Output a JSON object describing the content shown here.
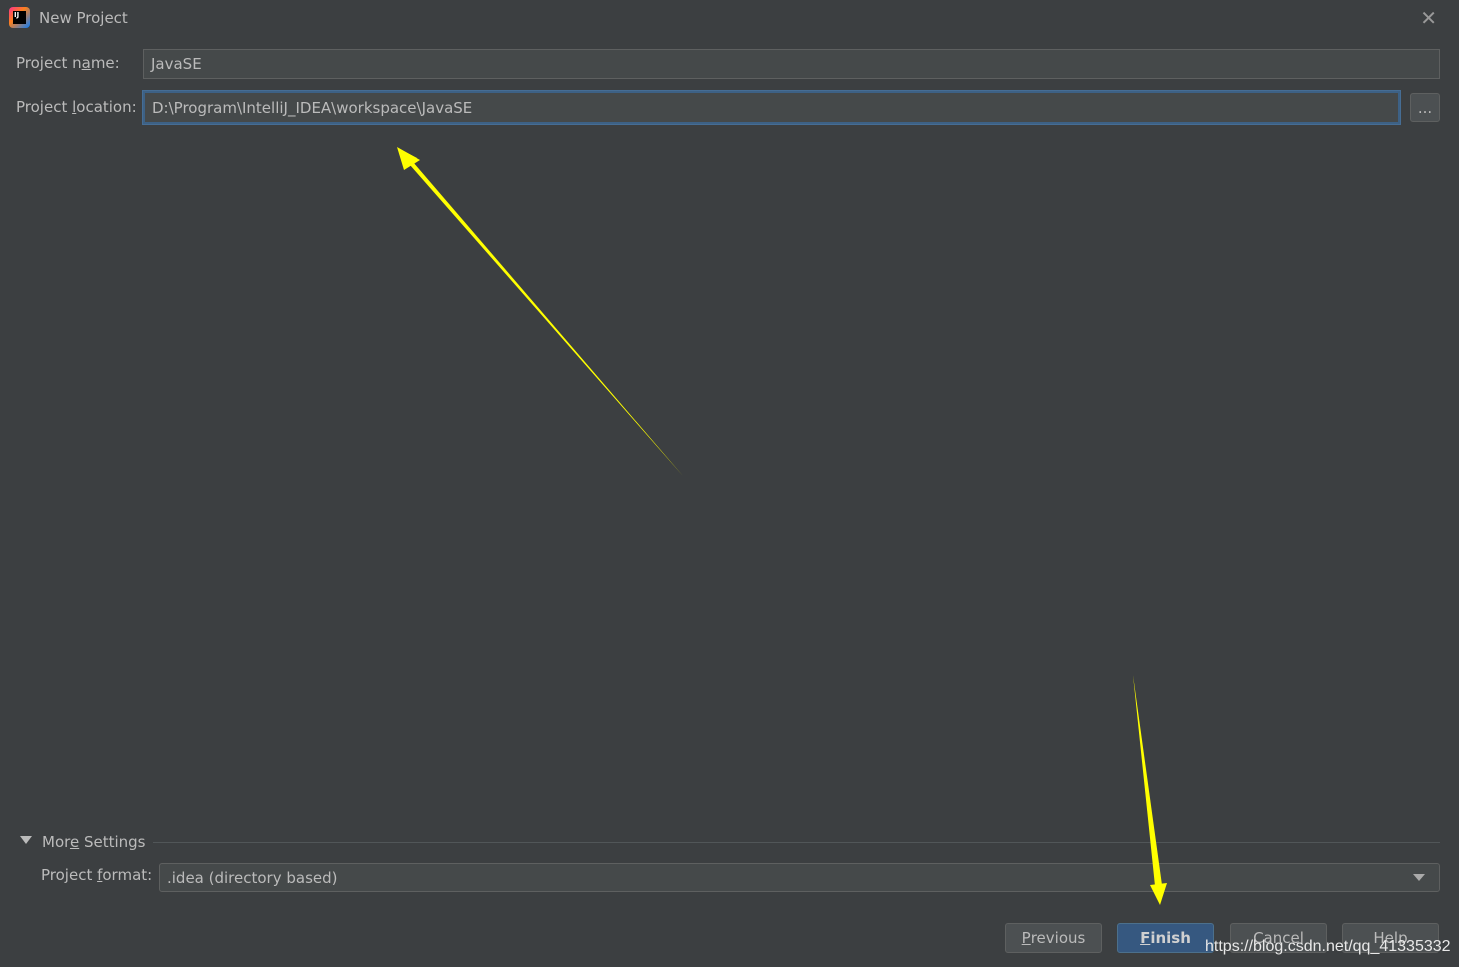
{
  "window": {
    "title": "New Project",
    "icon": "intellij-idea-logo",
    "close_icon": "close-icon"
  },
  "form": {
    "name_label_pre": "Project n",
    "name_label_mn": "a",
    "name_label_post": "me:",
    "name_value": "JavaSE",
    "location_label_pre": "Project ",
    "location_label_mn": "l",
    "location_label_post": "ocation:",
    "location_value": "D:\\Program\\IntelliJ_IDEA\\workspace\\JavaSE",
    "browse_label": "..."
  },
  "more_settings": {
    "label_pre": "Mor",
    "label_mn": "e",
    "label_post": " Settings",
    "expanded": true,
    "format_label_pre": "Project ",
    "format_label_mn": "f",
    "format_label_post": "ormat:",
    "format_value": ".idea (directory based)"
  },
  "buttons": {
    "previous_mn": "P",
    "previous_rest": "revious",
    "finish_mn": "F",
    "finish_rest": "inish",
    "cancel": "Cancel",
    "help": "Help"
  },
  "annotations": {
    "arrow_color": "#ffff00"
  },
  "watermark": "https://blog.csdn.net/qq_41335332",
  "colors": {
    "background": "#3c3f41",
    "field": "#45494a",
    "primary_button": "#365880",
    "focus_border": "#3d6185"
  }
}
